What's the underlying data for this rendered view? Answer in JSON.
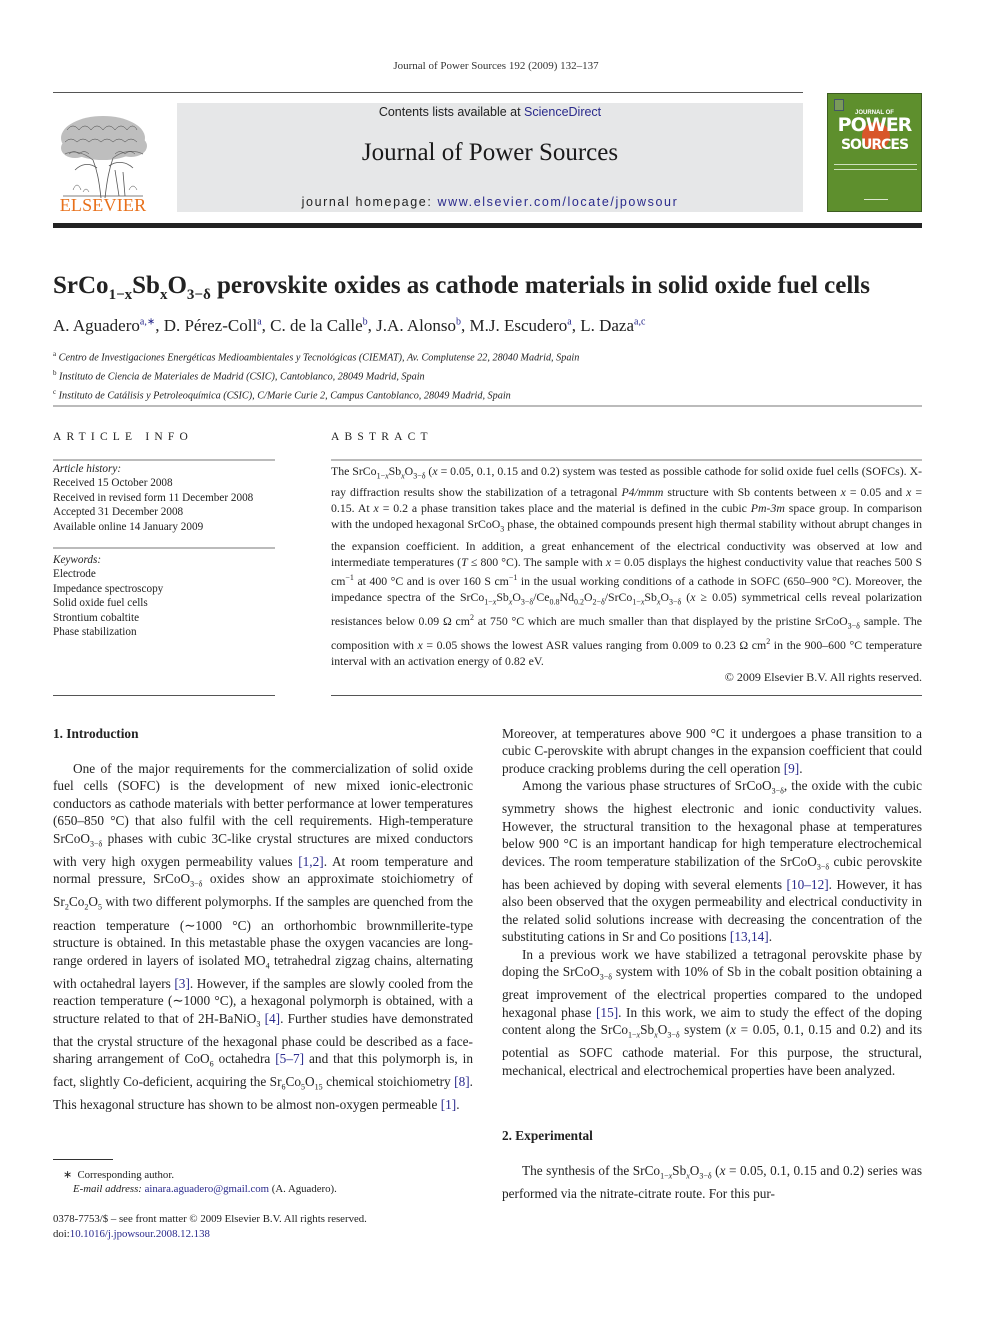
{
  "running_head": "Journal of Power Sources 192 (2009) 132–137",
  "publisher": {
    "logo_icon": "elsevier-tree-icon",
    "name": "ELSEVIER"
  },
  "banner": {
    "contents_prefix": "Contents lists available at ",
    "contents_link": "ScienceDirect",
    "journal_title": "Journal of Power Sources",
    "homepage_prefix": "journal homepage: ",
    "homepage_link": "www.elsevier.com/locate/jpowsour"
  },
  "cover": {
    "line1": "JOURNAL OF",
    "line2": "POWER",
    "line3": "SOURCES",
    "color": "#5e8f2d"
  },
  "article": {
    "title_parts": [
      "SrCo",
      "1−x",
      "Sb",
      "x",
      "O",
      "3−δ",
      " perovskite oxides as cathode materials in solid oxide fuel cells"
    ],
    "authors": [
      {
        "name": "A. Aguadero",
        "aff": "a,∗"
      },
      {
        "name": "D. Pérez-Coll",
        "aff": "a"
      },
      {
        "name": "C. de la Calle",
        "aff": "b"
      },
      {
        "name": "J.A. Alonso",
        "aff": "b"
      },
      {
        "name": "M.J. Escudero",
        "aff": "a"
      },
      {
        "name": "L. Daza",
        "aff": "a,c"
      }
    ],
    "affiliations": [
      {
        "key": "a",
        "text": "Centro de Investigaciones Energéticas Medioambientales y Tecnológicas (CIEMAT), Av. Complutense 22, 28040 Madrid, Spain"
      },
      {
        "key": "b",
        "text": "Instituto de Ciencia de Materiales de Madrid (CSIC), Cantoblanco, 28049 Madrid, Spain"
      },
      {
        "key": "c",
        "text": "Instituto de Catálisis y Petroleoquímica (CSIC), C/Marie Curie 2, Campus Cantoblanco, 28049 Madrid, Spain"
      }
    ]
  },
  "article_info": {
    "heading": "ARTICLE INFO",
    "history_label": "Article history:",
    "history": [
      "Received 15 October 2008",
      "Received in revised form 11 December 2008",
      "Accepted 31 December 2008",
      "Available online 14 January 2009"
    ],
    "keywords_label": "Keywords:",
    "keywords": [
      "Electrode",
      "Impedance spectroscopy",
      "Solid oxide fuel cells",
      "Strontium cobaltite",
      "Phase stabilization"
    ]
  },
  "abstract": {
    "heading": "ABSTRACT",
    "copyright": "© 2009 Elsevier B.V. All rights reserved."
  },
  "sections": {
    "intro_heading": "1.  Introduction",
    "experimental_heading": "2.  Experimental"
  },
  "footnote": {
    "star": "∗",
    "corresponding": "Corresponding author.",
    "email_label": "E-mail address:",
    "email": "ainara.aguadero@gmail.com",
    "email_suffix": " (A. Aguadero).",
    "front_matter": "0378-7753/$ – see front matter © 2009 Elsevier B.V. All rights reserved.",
    "doi_prefix": "doi:",
    "doi": "10.1016/j.jpowsour.2008.12.138"
  }
}
